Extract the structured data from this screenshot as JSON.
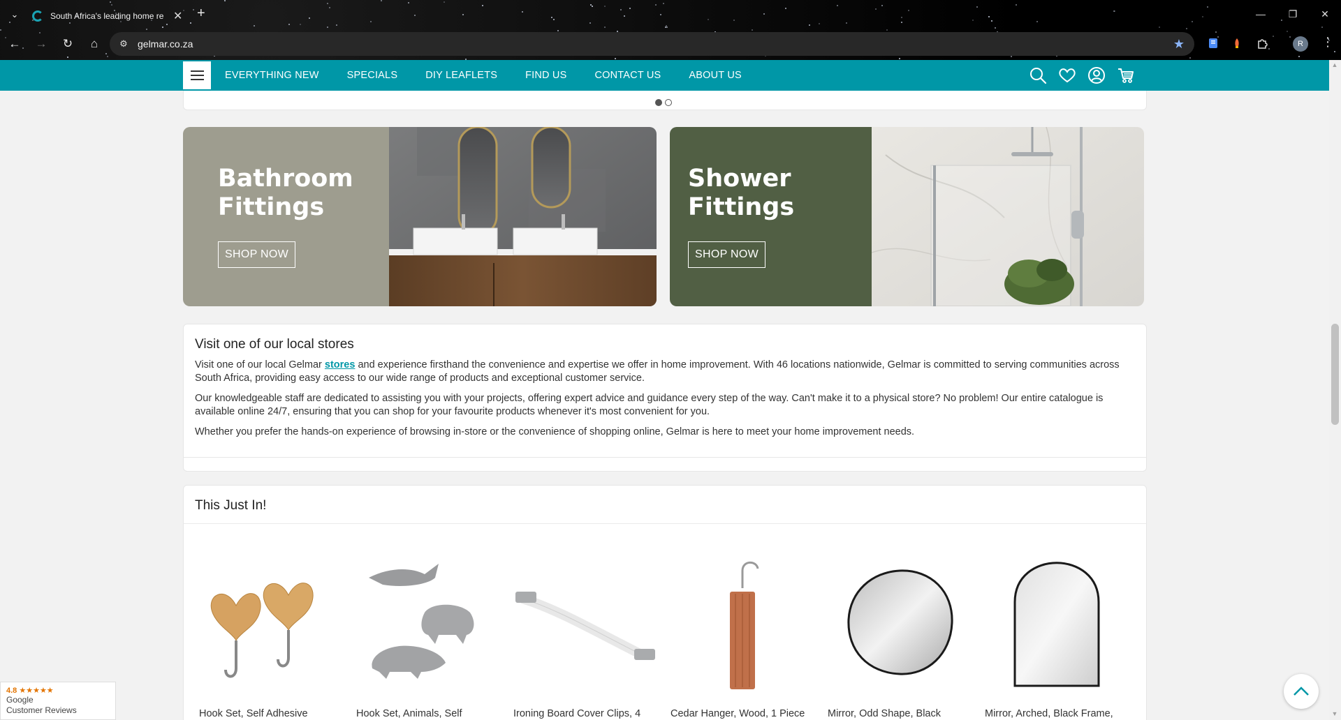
{
  "browser": {
    "tab_title": "South Africa's leading home re",
    "url": "gelmar.co.za",
    "profile_initial": "R"
  },
  "nav": {
    "menu": [
      "EVERYTHING NEW",
      "SPECIALS",
      "DIY LEAFLETS",
      "FIND US",
      "CONTACT US",
      "ABOUT US"
    ],
    "icons": [
      "search-icon",
      "wishlist-heart-icon",
      "account-icon",
      "cart-icon"
    ],
    "brand_color": "#0097a7"
  },
  "promos": [
    {
      "title_line1": "Bathroom",
      "title_line2": "Fittings",
      "button": "SHOP NOW",
      "panel_color": "#9e9d8f"
    },
    {
      "title_line1": "Shower",
      "title_line2": "Fittings",
      "button": "SHOP NOW",
      "panel_color": "#515f44"
    }
  ],
  "visit": {
    "heading": "Visit one of our local stores",
    "p1_before": "Visit one of our local Gelmar ",
    "p1_link": "stores",
    "p1_after": " and experience firsthand the convenience and expertise we offer in home improvement. With 46 locations nationwide, Gelmar is committed to serving communities across South Africa, providing easy access to our wide range of products and exceptional customer service.",
    "p2": "Our knowledgeable staff are dedicated to assisting you with your projects, offering expert advice and guidance every step of the way. Can't make it to a physical store? No problem! Our entire catalogue is available online 24/7, ensuring that you can shop for your favourite products whenever it's most convenient for you.",
    "p3": "Whether you prefer the hands-on experience of browsing in-store or the convenience of shopping online, Gelmar is here to meet your home improvement needs."
  },
  "just_in": {
    "heading": "This Just In!",
    "products": [
      {
        "name": "Hook Set, Self Adhesive"
      },
      {
        "name": "Hook Set, Animals, Self"
      },
      {
        "name": "Ironing Board Cover Clips, 4"
      },
      {
        "name": "Cedar Hanger, Wood, 1 Piece"
      },
      {
        "name": "Mirror, Odd Shape, Black"
      },
      {
        "name": "Mirror, Arched, Black Frame,"
      }
    ]
  },
  "reviews": {
    "rating": "4.8",
    "stars": "★★★★★",
    "line1": "Google",
    "line2": "Customer Reviews"
  },
  "slider": {
    "active_slide": 1,
    "total_slides": 2
  }
}
